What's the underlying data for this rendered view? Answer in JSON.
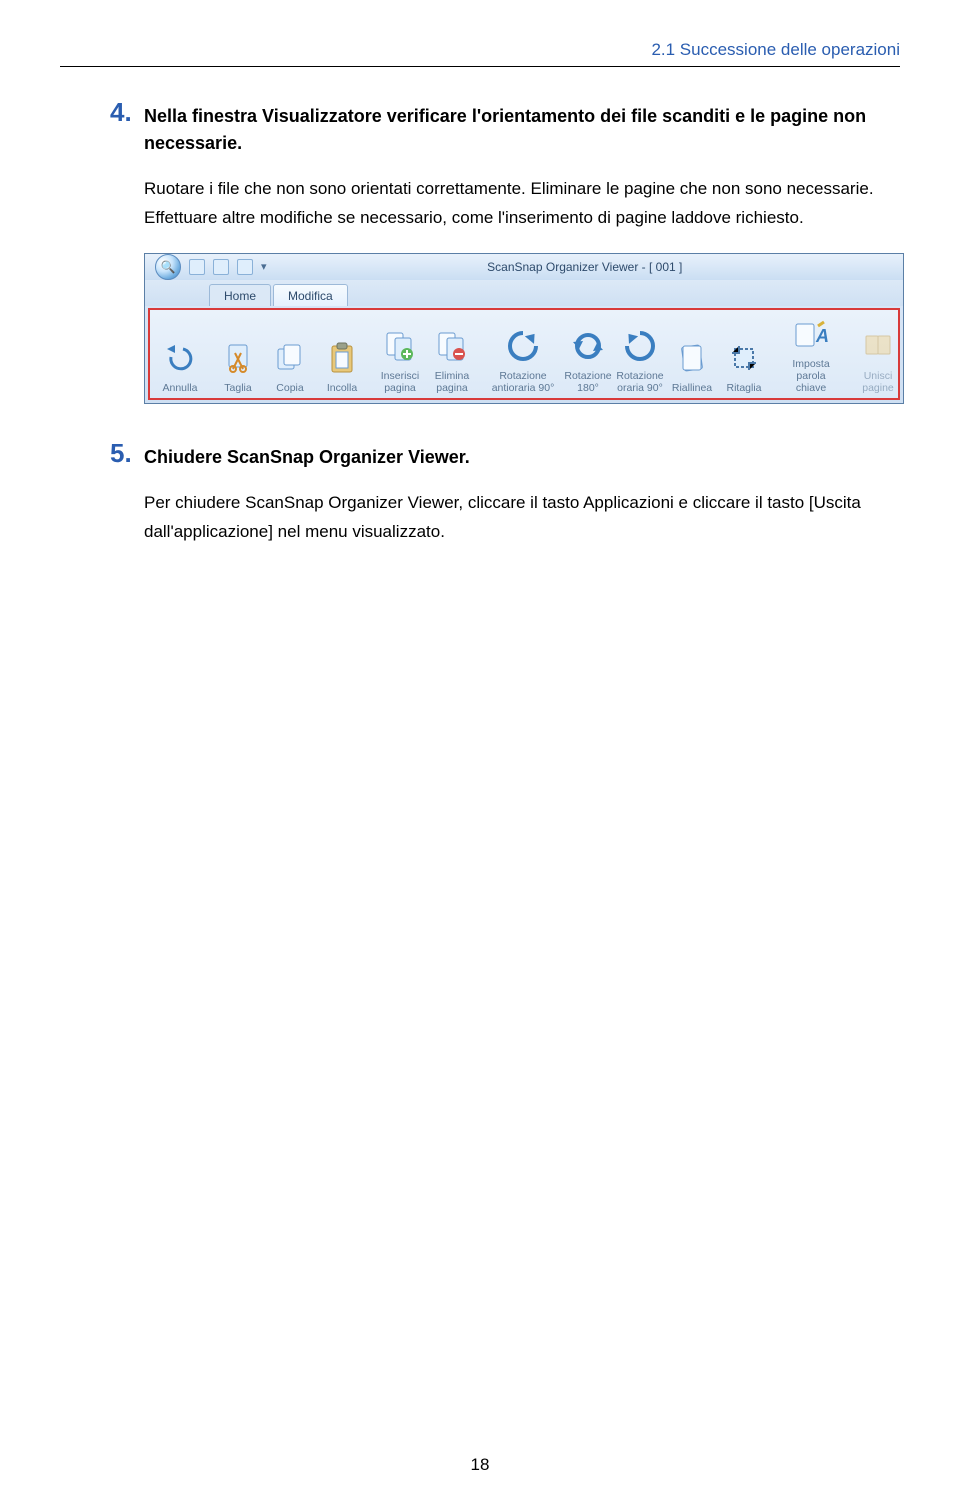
{
  "header": {
    "title": "2.1 Successione delle operazioni"
  },
  "step4": {
    "num": "4.",
    "title": "Nella finestra Visualizzatore verificare l'orientamento dei file scanditi e le pagine non necessarie.",
    "body": "Ruotare i file che non sono orientati correttamente. Eliminare le pagine che non sono necessarie.\nEffettuare altre modifiche se necessario, come l'inserimento di pagine laddove richiesto."
  },
  "screenshot": {
    "window_title": "ScanSnap Organizer Viewer - [ 001 ]",
    "tabs": {
      "home": "Home",
      "modifica": "Modifica"
    },
    "ribbon": {
      "annulla": "Annulla",
      "taglia": "Taglia",
      "copia": "Copia",
      "incolla": "Incolla",
      "inserisci_pagina": "Inserisci\npagina",
      "elimina_pagina": "Elimina\npagina",
      "rotazione_antioraria": "Rotazione\nantioraria 90°",
      "rotazione_180": "Rotazione\n180°",
      "rotazione_oraria": "Rotazione\noraria 90°",
      "riallinea": "Riallinea",
      "ritaglia": "Ritaglia",
      "imposta_parola": "Imposta\nparola chiave",
      "unisci_pagine": "Unisci\npagine"
    }
  },
  "step5": {
    "num": "5.",
    "title": "Chiudere ScanSnap Organizer Viewer.",
    "body": "Per chiudere ScanSnap Organizer Viewer, cliccare il tasto Applicazioni e cliccare il tasto [Uscita dall'applicazione] nel menu visualizzato."
  },
  "page_number": "18"
}
